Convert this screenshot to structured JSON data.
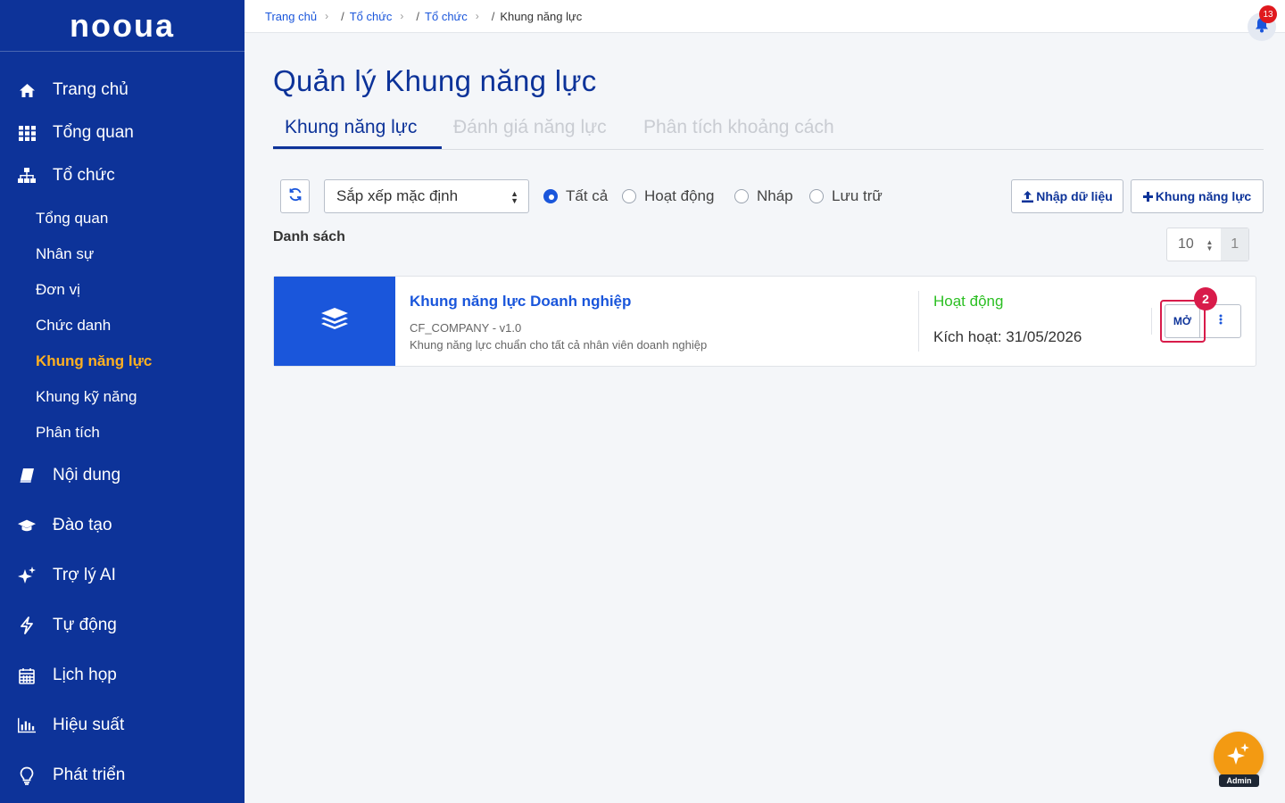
{
  "brand": {
    "logo_text": "nooua"
  },
  "sidebar": {
    "items": [
      {
        "label": "Trang chủ",
        "icon": "home-icon"
      },
      {
        "label": "Tổng quan",
        "icon": "grid-icon"
      },
      {
        "label": "Tổ chức",
        "icon": "org-chart-icon"
      },
      {
        "label": "Nội dung",
        "icon": "book-icon"
      },
      {
        "label": "Đào tạo",
        "icon": "graduation-cap-icon"
      },
      {
        "label": "Trợ lý AI",
        "icon": "sparkle-icon"
      },
      {
        "label": "Tự động",
        "icon": "bolt-icon"
      },
      {
        "label": "Lịch họp",
        "icon": "calendar-icon"
      },
      {
        "label": "Hiệu suất",
        "icon": "bar-chart-icon"
      },
      {
        "label": "Phát triển",
        "icon": "lightbulb-icon"
      }
    ],
    "sub_items": [
      {
        "label": "Tổng quan"
      },
      {
        "label": "Nhân sự"
      },
      {
        "label": "Đơn vị"
      },
      {
        "label": "Chức danh"
      },
      {
        "label": "Khung năng lực",
        "active": true
      },
      {
        "label": "Khung kỹ năng"
      },
      {
        "label": "Phân tích"
      }
    ]
  },
  "breadcrumb": {
    "items": [
      "Trang chủ",
      "Tổ chức",
      "Tổ chức"
    ],
    "current": "Khung năng lực",
    "separator": "/"
  },
  "notifications": {
    "count": "13"
  },
  "page": {
    "title": "Quản lý Khung năng lực",
    "tabs": [
      "Khung năng lực",
      "Đánh giá năng lực",
      "Phân tích khoảng cách"
    ],
    "active_tab": 0
  },
  "toolbar": {
    "sort_value": "Sắp xếp mặc định",
    "filters": [
      "Tất cả",
      "Hoạt động",
      "Nháp",
      "Lưu trữ"
    ],
    "selected_filter": "Tất cả",
    "import_label": "Nhập dữ liệu",
    "create_label": "Khung năng lực"
  },
  "list": {
    "label": "Danh sách",
    "page_size": "10",
    "page": "1",
    "items": [
      {
        "title": "Khung năng lực Doanh nghiệp",
        "code": "CF_COMPANY - v1.0",
        "description": "Khung năng lực chuẩn cho tất cả nhân viên doanh nghiệp",
        "status": "Hoạt động",
        "activated": "Kích hoạt: 31/05/2026",
        "open_label": "MỞ"
      }
    ]
  },
  "annotation": {
    "step": "2"
  },
  "assistant": {
    "label": "Admin"
  },
  "colors": {
    "sidebar_bg": "#0d3399",
    "accent": "#1a56db",
    "active_sub": "#ffb020",
    "status_active": "#2bbf22",
    "highlight": "#d81b4a",
    "fab": "#f39a12"
  }
}
